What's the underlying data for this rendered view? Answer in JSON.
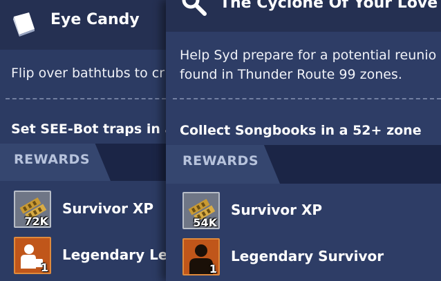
{
  "back_card": {
    "title": "Eye Candy",
    "icon": "book-icon",
    "description": "Flip over bathtubs to cr",
    "objective": "Set SEE-Bot traps in a",
    "rewards_label": "REWARDS",
    "rewards": [
      {
        "icon": "survivor-xp-icon",
        "quantity": "72K",
        "name": "Survivor XP"
      },
      {
        "icon": "legendary-lead-icon",
        "quantity": "1",
        "name": "Legendary Lea"
      }
    ]
  },
  "front_card": {
    "title": "The Cyclone Of Your Love",
    "icon": "magnifier-icon",
    "description_lines": [
      "Help Syd prepare for a potential reunio",
      "found in Thunder Route 99 zones."
    ],
    "objective": "Collect Songbooks in a 52+ zone",
    "rewards_label": "REWARDS",
    "rewards": [
      {
        "icon": "survivor-xp-icon",
        "quantity": "54K",
        "name": "Survivor XP"
      },
      {
        "icon": "legendary-survivor-icon",
        "quantity": "1",
        "name": "Legendary Survivor"
      }
    ]
  },
  "colors": {
    "card_body": "#2e3d66",
    "card_header": "#253052",
    "rewards_band": "#1b2546",
    "rewards_tab": "#35466f",
    "legendary_orange": "#c0561a"
  }
}
